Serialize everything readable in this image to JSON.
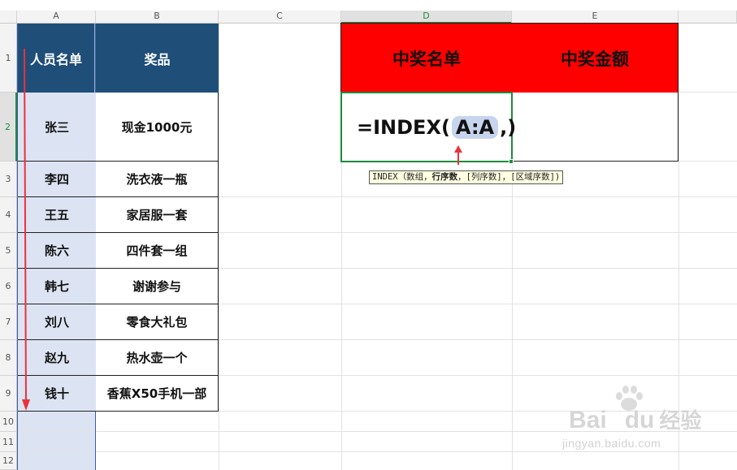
{
  "columns": [
    "A",
    "B",
    "C",
    "D",
    "E"
  ],
  "rows": [
    "1",
    "2",
    "3",
    "4",
    "5",
    "6",
    "7",
    "8",
    "9",
    "10",
    "11",
    "12"
  ],
  "headers": {
    "col_a": "人员名单",
    "col_b": "奖品",
    "col_d": "中奖名单",
    "col_e": "中奖金额"
  },
  "people": [
    "张三",
    "李四",
    "王五",
    "陈六",
    "韩七",
    "刘八",
    "赵九",
    "钱十"
  ],
  "prizes": [
    "现金1000元",
    "洗衣液一瓶",
    "家居服一套",
    "四件套一组",
    "谢谢参与",
    "零食大礼包",
    "热水壶一个",
    "香蕉X50手机一部"
  ],
  "formula": {
    "prefix": "=INDEX(",
    "ref": "A:A",
    "suffix": ",)"
  },
  "tooltip": {
    "func": "INDEX（数组，",
    "bold": "行序数",
    "rest": "，[列序数]，[区域序数])"
  },
  "watermark": {
    "logo": "Bai",
    "logo2": "du",
    "cn": "经验",
    "url": "jingyan.baidu.com"
  },
  "colors": {
    "header_blue": "#1f4e79",
    "red_header": "#ff0000",
    "selection_green": "#1e8a3c",
    "arrow_red": "#e8333c"
  }
}
